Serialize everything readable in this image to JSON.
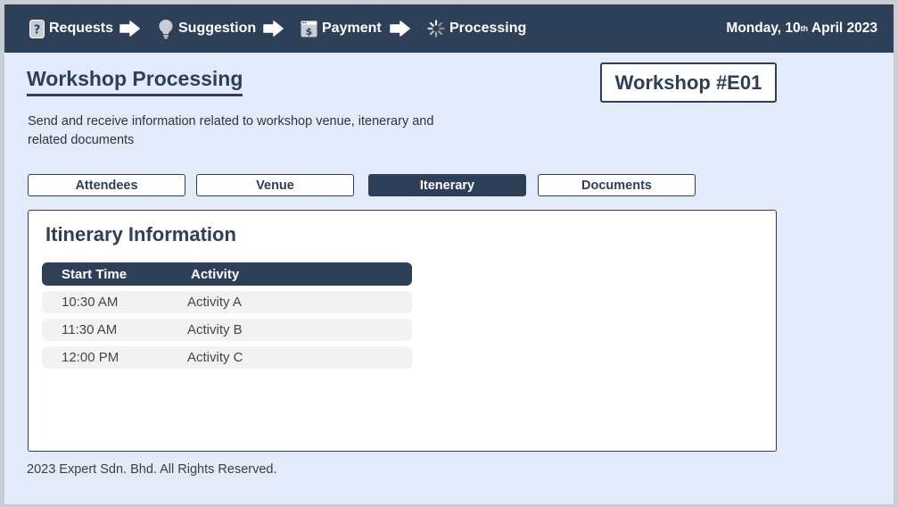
{
  "nav": {
    "steps": [
      {
        "label": "Requests",
        "icon": "question-page-icon"
      },
      {
        "label": "Suggestion",
        "icon": "lightbulb-icon"
      },
      {
        "label": "Payment",
        "icon": "payment-window-icon"
      },
      {
        "label": "Processing",
        "icon": "spinner-icon"
      }
    ],
    "date_prefix": "Monday, 10",
    "date_sup": "th",
    "date_suffix": " April 2023"
  },
  "header": {
    "title": "Workshop Processing",
    "workshop_id": "Workshop #E01",
    "description": "Send and receive information related to workshop venue, itenerary and related documents"
  },
  "tabs": [
    {
      "label": "Attendees",
      "active": false
    },
    {
      "label": "Venue",
      "active": false
    },
    {
      "label": "Itenerary",
      "active": true
    },
    {
      "label": "Documents",
      "active": false
    }
  ],
  "panel": {
    "title": "Itinerary Information",
    "columns": [
      "Start Time",
      "Activity"
    ],
    "rows": [
      {
        "start_time": "10:30 AM",
        "activity": "Activity A"
      },
      {
        "start_time": "11:30 AM",
        "activity": "Activity B"
      },
      {
        "start_time": "12:00 PM",
        "activity": "Activity C"
      }
    ]
  },
  "footer": {
    "text": "2023 Expert Sdn. Bhd. All Rights Reserved."
  },
  "colors": {
    "navy": "#2e4057",
    "background": "#e3eafa",
    "row_fill": "#f2f2f2",
    "white": "#ffffff"
  }
}
